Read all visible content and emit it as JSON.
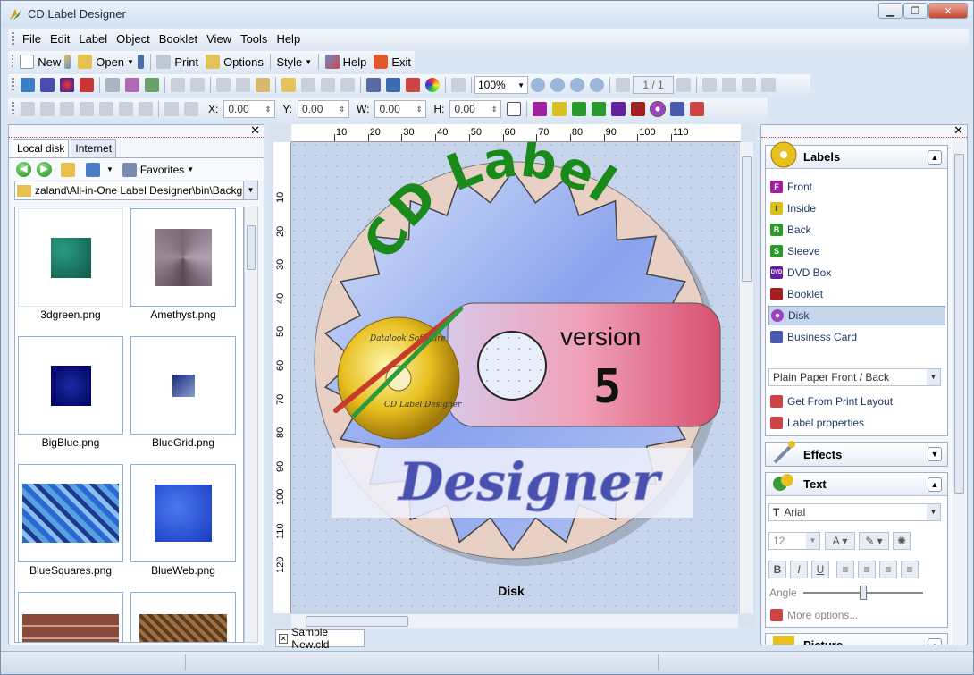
{
  "window": {
    "title": "CD Label Designer"
  },
  "menu": [
    "File",
    "Edit",
    "Label",
    "Object",
    "Booklet",
    "View",
    "Tools",
    "Help"
  ],
  "toolbar": {
    "new": "New",
    "open": "Open",
    "print": "Print",
    "options": "Options",
    "style": "Style",
    "help": "Help",
    "exit": "Exit",
    "zoom": "100%",
    "page": "1 / 1"
  },
  "position": {
    "x_label": "X:",
    "x": "0.00",
    "y_label": "Y:",
    "y": "0.00",
    "w_label": "W:",
    "w": "0.00",
    "h_label": "H:",
    "h": "0.00"
  },
  "left_panel": {
    "tabs": [
      "Local disk",
      "Internet"
    ],
    "favorites": "Favorites",
    "path": "zaland\\All-in-One Label Designer\\bin\\Backgrounds",
    "files": [
      "3dgreen.png",
      "Amethyst.png",
      "BigBlue.png",
      "BlueGrid.png",
      "BlueSquares.png",
      "BlueWeb.png"
    ]
  },
  "ruler": {
    "h": [
      "10",
      "20",
      "30",
      "40",
      "50",
      "60",
      "70",
      "80",
      "90",
      "100",
      "110"
    ],
    "v": [
      "10",
      "20",
      "30",
      "40",
      "50",
      "60",
      "70",
      "80",
      "90",
      "100",
      "110",
      "120"
    ]
  },
  "canvas": {
    "arc_text": "CD Label",
    "version_text": "version",
    "version_number": "5",
    "designer_text": "Designer",
    "logo_top": "Datalook Software",
    "logo_bottom": "CD Label Designer",
    "caption": "Disk"
  },
  "doc_tab": "Sample New.cld",
  "labels_panel": {
    "title": "Labels",
    "items": [
      "Front",
      "Inside",
      "Back",
      "Sleeve",
      "DVD Box",
      "Booklet",
      "Disk",
      "Business Card"
    ],
    "selected": "Disk",
    "paper": "Plain Paper Front / Back",
    "links": [
      "Get From Print Layout",
      "Label properties"
    ]
  },
  "effects_panel": {
    "title": "Effects"
  },
  "text_panel": {
    "title": "Text",
    "font": "Arial",
    "size": "12",
    "angle_label": "Angle",
    "angle_value": 0.5,
    "more": "More options..."
  },
  "picture_panel": {
    "title": "Picture"
  }
}
